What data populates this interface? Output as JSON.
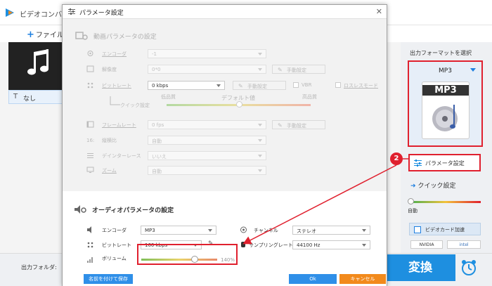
{
  "app": {
    "title": "ビデオコンバ",
    "add_file": "ファイル",
    "none_label": "なし",
    "output_format_label": "出力フォーマットを選択",
    "format_name": "MP3",
    "format_icon_text": "MP3",
    "param_button": "パラメータ設定",
    "quick_setting": "クイック設定",
    "auto_label": "自動",
    "gpu_accel": "ビデオカード加速",
    "nvidia": "NVIDIA",
    "intel": "intel",
    "output_folder": "出力フォルダ:",
    "convert": "変換",
    "callout_number": "2",
    "accent_color": "#1e8fe0",
    "highlight_color": "#e0202e"
  },
  "dialog": {
    "title": "パラメータ設定",
    "video": {
      "section_title": "動画パラメータの設定",
      "encoder_label": "エンコーダ",
      "encoder_value": "-1",
      "resolution_label": "解像度",
      "resolution_value": "0*0",
      "resolution_button": "手動設定",
      "bitrate_label": "ビットレート",
      "bitrate_value": "0 kbps",
      "bitrate_button": "手動設定",
      "vbr_label": "VBR",
      "lossless_label": "ロスレスモード",
      "quick_label": "クイック設定",
      "low_quality": "低品質",
      "default_value": "デフォルト値",
      "high_quality": "高品質",
      "framerate_label": "フレームレート",
      "framerate_value": "0 fps",
      "framerate_button": "手動設定",
      "aspect_label": "縦横比",
      "aspect_value": "自動",
      "deinterlace_label": "デインターレース",
      "deinterlace_value": "いいえ",
      "zoom_label": "ズーム",
      "zoom_value": "自動"
    },
    "audio": {
      "section_title": "オーディオパラメータの設定",
      "encoder_label": "エンコーダ",
      "encoder_value": "MP3",
      "channel_label": "チャンネル",
      "channel_value": "ステレオ",
      "bitrate_label": "ビットレート",
      "bitrate_value": "160 kbps",
      "sampling_label": "サンプリングレート",
      "sampling_value": "44100 Hz",
      "volume_label": "ボリューム",
      "volume_value": "140%",
      "volume_level": 0.7
    },
    "footer": {
      "save_as": "名前を付けて保存",
      "ok": "Ok",
      "cancel": "キャンセル"
    }
  }
}
